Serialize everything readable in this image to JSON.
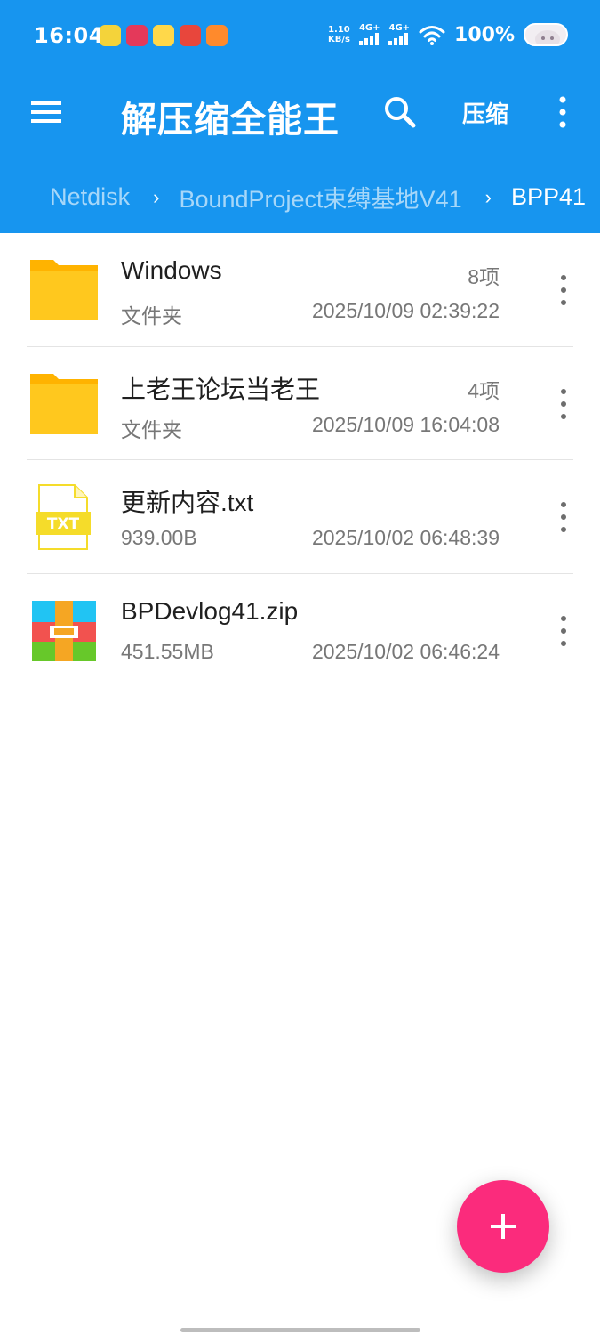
{
  "status_bar": {
    "time": "16:04",
    "net_speed_value": "1.10",
    "net_speed_unit": "KB/s",
    "signal_1_label": "4G+",
    "signal_2_label": "4G+",
    "battery": "100%",
    "notification_icons": [
      "green-app-icon",
      "red-app-icon",
      "yellow-rabbit-app-icon",
      "red-mushroom-app-icon",
      "orange-app-icon"
    ]
  },
  "app_bar": {
    "title": "解压缩全能王",
    "compress_label": "压缩"
  },
  "breadcrumb": {
    "items": [
      "Netdisk",
      "BoundProject束缚基地V41",
      "BPP41"
    ]
  },
  "files": [
    {
      "name": "Windows",
      "type": "文件夹",
      "count": "8项",
      "date": "2025/10/09 02:39:22",
      "icon": "folder-icon"
    },
    {
      "name": "上老王论坛当老王",
      "type": "文件夹",
      "count": "4项",
      "date": "2025/10/09 16:04:08",
      "icon": "folder-icon"
    },
    {
      "name": "更新内容.txt",
      "type": "939.00B",
      "count": "",
      "date": "2025/10/02 06:48:39",
      "icon": "txt-file-icon"
    },
    {
      "name": "BPDevlog41.zip",
      "type": "451.55MB",
      "count": "",
      "date": "2025/10/02 06:46:24",
      "icon": "zip-file-icon"
    }
  ],
  "txt_icon_label": "TXT",
  "fab": {
    "icon": "plus-icon"
  },
  "colors": {
    "primary": "#1795ef",
    "accent": "#fb2b7c",
    "folder": "#ffc300"
  }
}
